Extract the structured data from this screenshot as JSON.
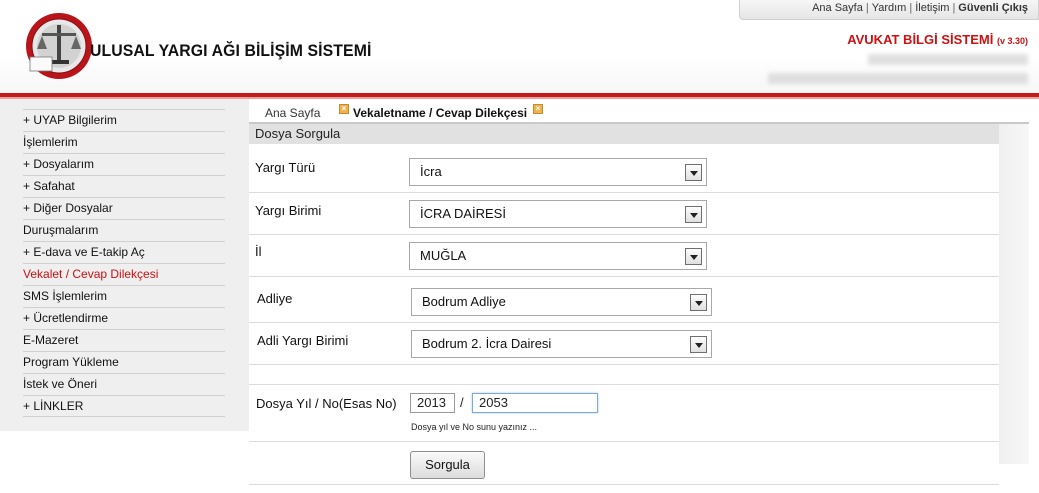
{
  "header": {
    "app_title": "ULUSAL YARGI AĞI BİLİŞİM SİSTEMİ",
    "subtitle": "AVUKAT BİLGİ SİSTEMİ",
    "version": "(v 3.30)",
    "top_links": [
      "Ana Sayfa",
      "Yardım",
      "İletişim",
      "Güvenli Çıkış"
    ]
  },
  "sidebar": {
    "items": [
      {
        "label": "+ UYAP Bilgilerim"
      },
      {
        "label": "İşlemlerim"
      },
      {
        "label": "+ Dosyalarım"
      },
      {
        "label": "+ Safahat"
      },
      {
        "label": "+ Diğer Dosyalar"
      },
      {
        "label": "Duruşmalarım"
      },
      {
        "label": "+ E-dava ve E-takip Aç"
      },
      {
        "label": "Vekalet / Cevap Dilekçesi"
      },
      {
        "label": "SMS İşlemlerim"
      },
      {
        "label": "+ Ücretlendirme"
      },
      {
        "label": "E-Mazeret"
      },
      {
        "label": "Program Yükleme"
      },
      {
        "label": "İstek ve Öneri"
      },
      {
        "label": "+ LİNKLER"
      }
    ],
    "active_index": 7
  },
  "tabs": [
    {
      "label": "Ana Sayfa"
    },
    {
      "label": "Vekaletname / Cevap Dilekçesi"
    }
  ],
  "section": {
    "title": "Dosya Sorgula"
  },
  "form": {
    "yargi_turu": {
      "label": "Yargı Türü",
      "value": "İcra"
    },
    "yargi_birimi": {
      "label": "Yargı Birimi",
      "value": "İCRA DAİRESİ"
    },
    "il": {
      "label": "İl",
      "value": "MUĞLA"
    },
    "adliye": {
      "label": "Adliye",
      "value": "Bodrum Adliye"
    },
    "adli_yargi_birimi": {
      "label": "Adli Yargı Birimi",
      "value": "Bodrum 2. İcra Dairesi"
    },
    "dosya": {
      "label": "Dosya Yıl / No(Esas No)",
      "year": "2013",
      "separator": "/",
      "number": "2053",
      "hint": "Dosya yıl ve No sunu yazınız ..."
    },
    "submit_label": "Sorgula"
  },
  "colors": {
    "accent_red": "#cc1111",
    "sidebar_bg": "#efefef",
    "section_bg": "#e1e1e1"
  }
}
